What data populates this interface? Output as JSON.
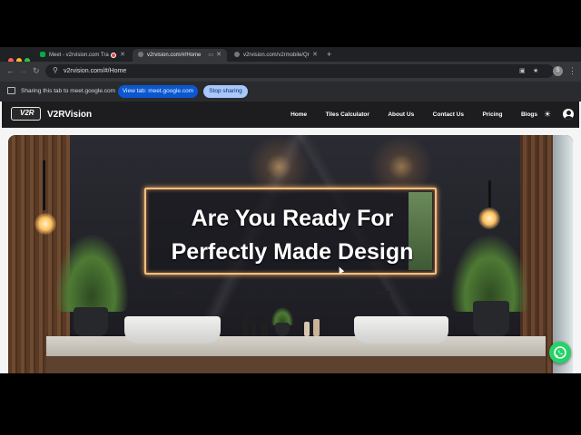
{
  "browser": {
    "tabs": [
      {
        "title": "Meet - v2rvision.com Tra",
        "active": false
      },
      {
        "title": "v2rvision.com/#/Home",
        "active": true
      },
      {
        "title": "v2rvision.com/v2rmobile/Qr",
        "active": false
      }
    ],
    "new_tab_label": "+",
    "url": "v2rvision.com/#/Home",
    "profile_initial": "S"
  },
  "sharing_bar": {
    "message": "Sharing this tab to meet.google.com",
    "view_tab_label": "View tab: meet.google.com",
    "stop_sharing_label": "Stop sharing"
  },
  "site": {
    "logo_text": "V2R",
    "brand": "V2RVision",
    "nav": [
      "Home",
      "Tiles Calculator",
      "About Us",
      "Contact Us",
      "Pricing",
      "Blogs"
    ],
    "hero": {
      "line1": "Are You Ready For",
      "line2": "Perfectly Made Design"
    }
  },
  "colors": {
    "accent_blue": "#0b57d0",
    "stop_button": "#a8c7fa",
    "whatsapp_green": "#25d366",
    "nav_background": "#1d1d1f"
  }
}
